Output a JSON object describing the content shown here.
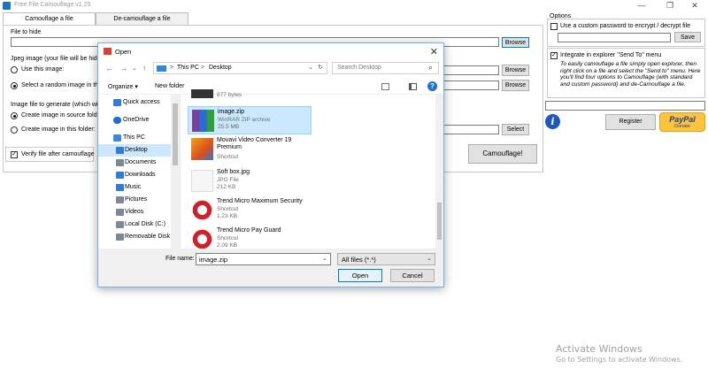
{
  "window": {
    "title": "Free File Camouflage v1.25"
  },
  "tabs": [
    {
      "label": "Camouflage a file"
    },
    {
      "label": "De-camouflage a file"
    }
  ],
  "main": {
    "file_to_hide": {
      "label": "File to hide",
      "browse": "Browse"
    },
    "jpeg": {
      "label": "Jpeg image (your file will be hidden i",
      "use_image": "Use this image:",
      "random_image": "Select a random image in this fo",
      "browse": "Browse"
    },
    "generate": {
      "label": "Image file to generate (which will co",
      "source_folder": "Create image in source folder",
      "this_folder": "Create image in this folder:",
      "select": "Select"
    },
    "verify": "Verify file after camouflage",
    "camouflage_button": "Camouflage!"
  },
  "options": {
    "title": "Options",
    "custom_password": "Use a custom password to encrypt / decrypt file",
    "save": "Save",
    "send_to": "Integrate in explorer \"Send To\" menu",
    "send_to_desc": "To easily camouflage a file simply open explorer, then right click on a file and select the \"Send to\" menu. Here you'll find four options to Camouflage (with standard and custom password) and de-Camouflage a file.",
    "register": "Register",
    "paypal": "PayPal",
    "donate": "Donate",
    "info_icon_glyph": "i"
  },
  "dialog": {
    "title": "Open",
    "close_glyph": "✕",
    "nav": {
      "back": "←",
      "forward": "→",
      "up": "↑",
      "dropdown": "⌄",
      "refresh": "↻",
      "search_glyph": "⌕"
    },
    "breadcrumb": [
      "This PC",
      "Desktop"
    ],
    "separator": ">",
    "search_placeholder": "Search Desktop",
    "organize": "Organize ▾",
    "new_folder": "New folder",
    "help": "?",
    "sidebar": [
      {
        "label": "Quick access",
        "icon": "star-icon",
        "color": "#2f7dd6"
      },
      {
        "label": "OneDrive",
        "icon": "cloud-icon",
        "color": "#1e6fd0"
      },
      {
        "label": "This PC",
        "icon": "computer-icon",
        "color": "#3a8ad6"
      },
      {
        "label": "Desktop",
        "icon": "desktop-icon",
        "color": "#2f7dd6"
      },
      {
        "label": "Documents",
        "icon": "documents-icon",
        "color": "#7a8a99"
      },
      {
        "label": "Downloads",
        "icon": "downloads-icon",
        "color": "#2f7dd6"
      },
      {
        "label": "Music",
        "icon": "music-icon",
        "color": "#2f7dd6"
      },
      {
        "label": "Pictures",
        "icon": "pictures-icon",
        "color": "#7a8a99"
      },
      {
        "label": "Videos",
        "icon": "videos-icon",
        "color": "#7a8a99"
      },
      {
        "label": "Local Disk (C:)",
        "icon": "disk-icon",
        "color": "#7a8a99"
      },
      {
        "label": "Removable Disk",
        "icon": "removable-disk-icon",
        "color": "#7a8a99"
      }
    ],
    "files": [
      {
        "name": "",
        "type": "",
        "size": "877 bytes",
        "icon": "partial-image-icon",
        "color": "#333"
      },
      {
        "name": "image.zip",
        "type": "WinRAR ZIP archive",
        "size": "25.5 MB",
        "icon": "winrar-icon",
        "color": "#7b3fa0"
      },
      {
        "name": "Movavi Video Converter 19 Premium",
        "type": "Shortcut",
        "size": "",
        "icon": "movavi-icon",
        "color": "#e07b1c"
      },
      {
        "name": "Soft box.jpg",
        "type": "JPG File",
        "size": "212 KB",
        "icon": "jpg-icon",
        "color": "#c0392b"
      },
      {
        "name": "Trend Micro Maximum Security",
        "type": "Shortcut",
        "size": "1.23 KB",
        "icon": "trend-micro-icon",
        "color": "#d0202a"
      },
      {
        "name": "Trend Micro Pay Guard",
        "type": "Shortcut",
        "size": "2.09 KB",
        "icon": "trend-micro-icon",
        "color": "#d0202a"
      }
    ],
    "filename_label": "File name:",
    "filename_value": "image.zip",
    "filetype": "All files (*.*)",
    "open": "Open",
    "cancel": "Cancel"
  },
  "watermark": {
    "line1": "Activate Windows",
    "line2": "Go to Settings to activate Windows."
  }
}
